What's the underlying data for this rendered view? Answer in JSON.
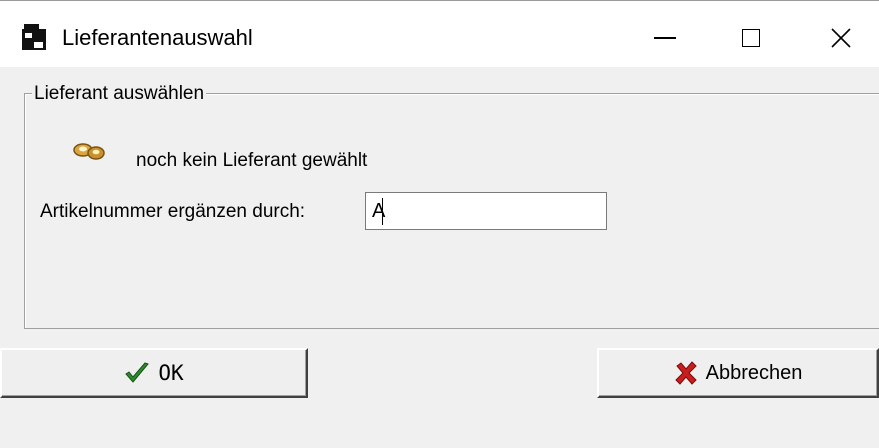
{
  "window": {
    "title": "Lieferantenauswahl",
    "controls": {
      "minimize": "minimize",
      "maximize": "maximize",
      "close": "close"
    }
  },
  "group": {
    "legend": "Lieferant auswählen",
    "status_text": "noch kein Lieferant gewählt",
    "field_label": "Artikelnummer ergänzen durch:",
    "field_value": "A"
  },
  "buttons": {
    "ok_label": "OK",
    "cancel_label": "Abbrechen"
  },
  "icons": {
    "app": "database-window-icon",
    "status": "search-lens-icon",
    "ok": "checkmark-icon",
    "cancel": "red-x-icon"
  },
  "colors": {
    "ok_check": "#2e8b2e",
    "cancel_x": "#c81e1e",
    "dialog_bg": "#f0f0f0"
  }
}
